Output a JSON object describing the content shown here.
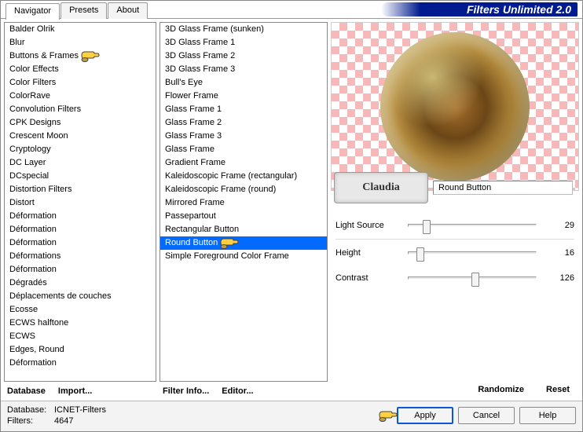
{
  "header": {
    "tabs": [
      "Navigator",
      "Presets",
      "About"
    ],
    "active_tab": 0,
    "title": "Filters Unlimited 2.0"
  },
  "categories": {
    "items": [
      "Balder Olrik",
      "Blur",
      "Buttons & Frames",
      "Color Effects",
      "Color Filters",
      "ColorRave",
      "Convolution Filters",
      "CPK Designs",
      "Crescent Moon",
      "Cryptology",
      "DC Layer",
      "DCspecial",
      "Distortion Filters",
      "Distort",
      "Déformation",
      "Déformation",
      "Déformation",
      "Déformations",
      "Déformation",
      "Dégradés",
      "Déplacements de couches",
      "Ecosse",
      "ECWS halftone",
      "ECWS",
      "Edges, Round",
      "Déformation"
    ],
    "selected_index": 2,
    "buttons": {
      "database": "Database",
      "import": "Import..."
    }
  },
  "filters": {
    "items": [
      "3D Glass Frame (sunken)",
      "3D Glass Frame 1",
      "3D Glass Frame 2",
      "3D Glass Frame 3",
      "Bull's Eye",
      "Flower Frame",
      "Glass Frame 1",
      "Glass Frame 2",
      "Glass Frame 3",
      "Glass Frame",
      "Gradient Frame",
      "Kaleidoscopic Frame (rectangular)",
      "Kaleidoscopic Frame (round)",
      "Mirrored Frame",
      "Passepartout",
      "Rectangular Button",
      "Round Button",
      "Simple Foreground Color Frame"
    ],
    "selected_index": 16,
    "buttons": {
      "info": "Filter Info...",
      "editor": "Editor..."
    }
  },
  "right": {
    "filter_name": "Round Button",
    "watermark": "Claudia",
    "params": [
      {
        "label": "Light Source",
        "value": 29,
        "max": 255
      },
      {
        "label": "Height",
        "value": 16,
        "max": 255
      },
      {
        "label": "Contrast",
        "value": 126,
        "max": 255
      }
    ],
    "buttons": {
      "randomize": "Randomize",
      "reset": "Reset"
    }
  },
  "status": {
    "db_label": "Database:",
    "db_value": "ICNET-Filters",
    "filters_label": "Filters:",
    "filters_value": "4647"
  },
  "main_buttons": {
    "apply": "Apply",
    "cancel": "Cancel",
    "help": "Help"
  }
}
